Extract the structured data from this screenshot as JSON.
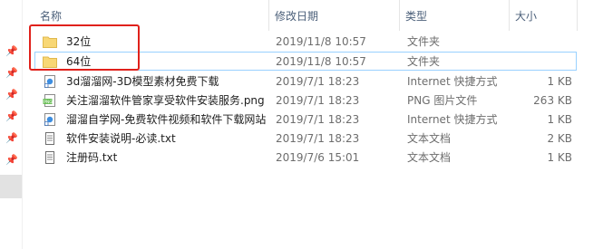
{
  "columns": {
    "name": "名称",
    "date": "修改日期",
    "type": "类型",
    "size": "大小"
  },
  "files": [
    {
      "name": "32位",
      "date": "2019/11/8 10:57",
      "type": "文件夹",
      "size": "",
      "icon": "folder-icon"
    },
    {
      "name": "64位",
      "date": "2019/11/8 10:57",
      "type": "文件夹",
      "size": "",
      "icon": "folder-icon"
    },
    {
      "name": "3d溜溜网-3D模型素材免费下载",
      "date": "2019/7/1 18:23",
      "type": "Internet 快捷方式",
      "size": "1 KB",
      "icon": "internet-shortcut-icon"
    },
    {
      "name": "关注溜溜软件管家享受软件安装服务.png",
      "date": "2019/7/1 18:23",
      "type": "PNG 图片文件",
      "size": "263 KB",
      "icon": "png-file-icon"
    },
    {
      "name": "溜溜自学网-免费软件视频和软件下载网站",
      "date": "2019/7/1 18:23",
      "type": "Internet 快捷方式",
      "size": "1 KB",
      "icon": "internet-shortcut-icon"
    },
    {
      "name": "软件安装说明-必读.txt",
      "date": "2019/7/1 18:23",
      "type": "文本文档",
      "size": "2 KB",
      "icon": "text-file-icon"
    },
    {
      "name": "注册码.txt",
      "date": "2019/7/6 15:01",
      "type": "文本文档",
      "size": "1 KB",
      "icon": "text-file-icon"
    }
  ],
  "colors": {
    "header_text": "#4c607a",
    "selection_border": "#99d1ff",
    "annotation_box": "#e0211b",
    "folder": "#f8d775"
  },
  "nav_icons": [
    "pin-icon",
    "pin-icon",
    "pin-icon",
    "pin-icon",
    "pin-icon",
    "pin-icon"
  ]
}
